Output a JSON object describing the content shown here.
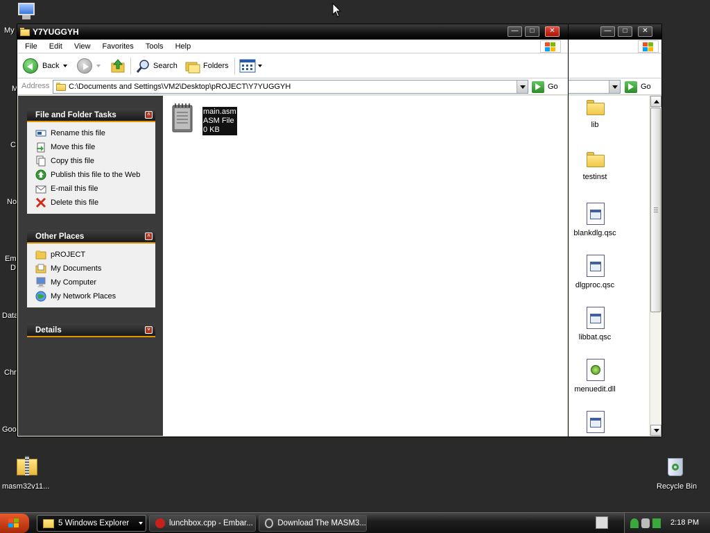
{
  "desktop": {
    "left_labels": [
      "My",
      "M",
      "C",
      "No",
      "Em",
      "D",
      "Data",
      "Chr",
      "Goo"
    ],
    "masm_icon_label": "masm32v11...",
    "recycle_bin_label": "Recycle Bin"
  },
  "back_window": {
    "go_label": "Go",
    "items": [
      {
        "label": "lib",
        "icon": "folder-icon"
      },
      {
        "label": "testinst",
        "icon": "folder-icon"
      },
      {
        "label": "blankdlg.qsc",
        "icon": "qsc-file-icon"
      },
      {
        "label": "dlgproc.qsc",
        "icon": "qsc-file-icon"
      },
      {
        "label": "libbat.qsc",
        "icon": "qsc-file-icon"
      },
      {
        "label": "menuedit.dll",
        "icon": "dll-file-icon"
      }
    ]
  },
  "window": {
    "title": "Y7YUGGYH",
    "menu": [
      "File",
      "Edit",
      "View",
      "Favorites",
      "Tools",
      "Help"
    ],
    "toolbar": {
      "back": "Back",
      "search": "Search",
      "folders": "Folders"
    },
    "address": {
      "label": "Address",
      "path": "C:\\Documents and Settings\\VM2\\Desktop\\pROJECT\\Y7YUGGYH",
      "go": "Go"
    },
    "file_tasks": {
      "title": "File and Folder Tasks",
      "items": [
        {
          "label": "Rename this file",
          "icon": "rename-icon"
        },
        {
          "label": "Move this file",
          "icon": "move-icon"
        },
        {
          "label": "Copy this file",
          "icon": "copy-icon"
        },
        {
          "label": "Publish this file to the Web",
          "icon": "publish-web-icon"
        },
        {
          "label": "E-mail this file",
          "icon": "email-icon"
        },
        {
          "label": "Delete this file",
          "icon": "delete-icon"
        }
      ]
    },
    "other_places": {
      "title": "Other Places",
      "items": [
        {
          "label": "pROJECT",
          "icon": "folder-icon"
        },
        {
          "label": "My Documents",
          "icon": "my-documents-icon"
        },
        {
          "label": "My Computer",
          "icon": "my-computer-icon"
        },
        {
          "label": "My Network Places",
          "icon": "network-places-icon"
        }
      ]
    },
    "details": {
      "title": "Details"
    },
    "file": {
      "name": "main.asm",
      "type": "ASM File",
      "size": "0 KB"
    }
  },
  "taskbar": {
    "buttons": [
      {
        "label": "5 Windows Explorer"
      },
      {
        "label": "lunchbox.cpp - Embar..."
      },
      {
        "label": "Download The MASM3..."
      }
    ],
    "clock": "2:18 PM"
  }
}
